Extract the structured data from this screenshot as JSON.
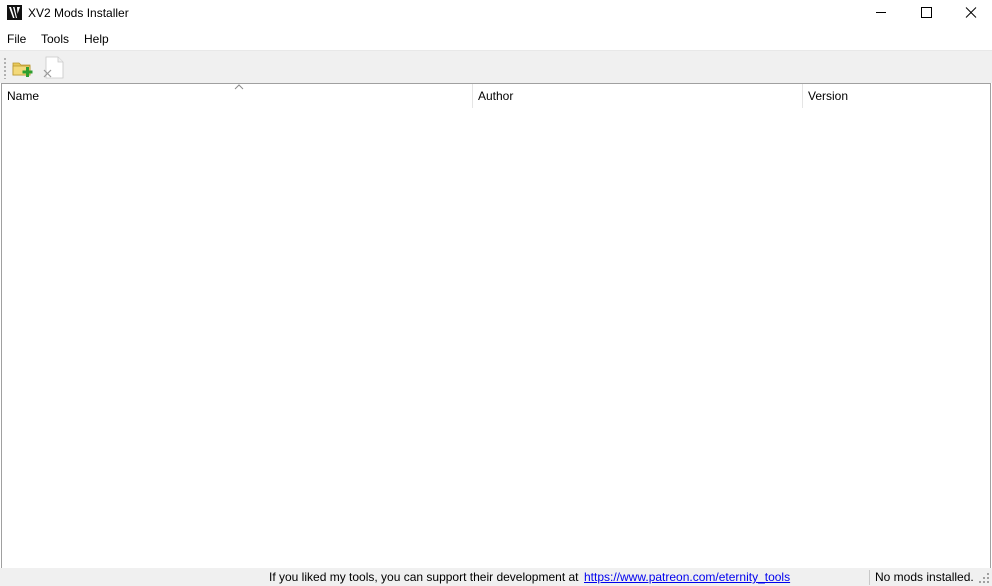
{
  "window": {
    "title": "XV2 Mods Installer",
    "icon": "xv2-logo-icon",
    "controls": [
      "minimize-icon",
      "maximize-icon",
      "close-icon"
    ]
  },
  "menu": {
    "items": [
      {
        "label": "File"
      },
      {
        "label": "Tools"
      },
      {
        "label": "Help"
      }
    ]
  },
  "toolbar": {
    "buttons": [
      {
        "icon": "folder-add-icon"
      },
      {
        "icon": "document-remove-icon"
      }
    ]
  },
  "mods_list": {
    "columns": [
      {
        "label": "Name",
        "sorted": "ascending"
      },
      {
        "label": "Author"
      },
      {
        "label": "Version"
      }
    ],
    "rows": []
  },
  "status": {
    "message": "If you liked my tools, you can support their development at",
    "link": "https://www.patreon.com/eternity_tools",
    "count": "No mods installed."
  },
  "colors": {
    "link": "#0000ee",
    "toolbar_bg": "#f0f0f0",
    "folder": "#e8c85a",
    "plus": "#2e9e2e"
  }
}
